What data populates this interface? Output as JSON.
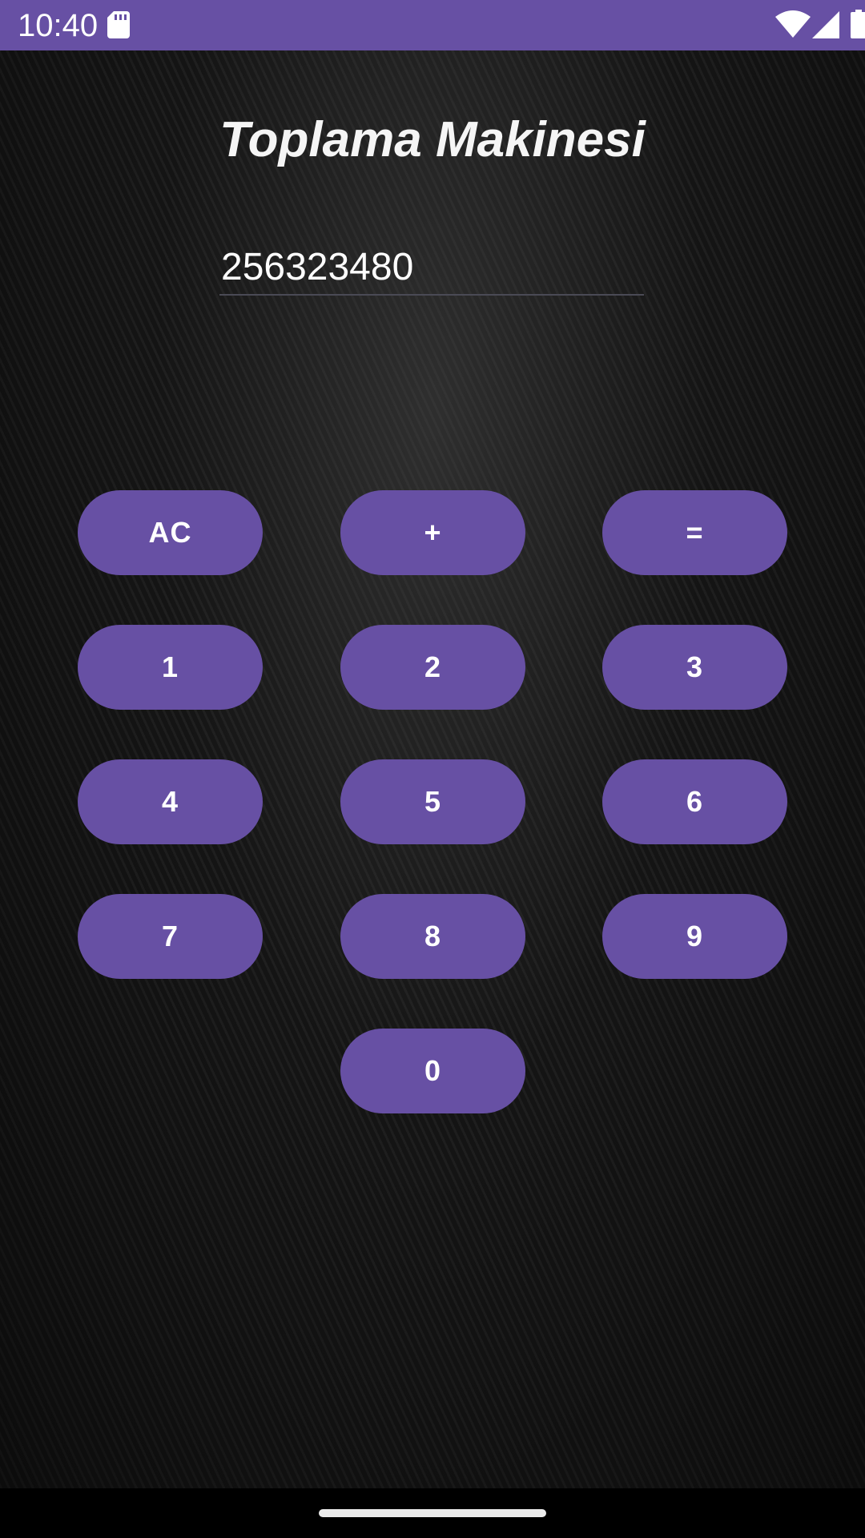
{
  "status_bar": {
    "time": "10:40",
    "background": "#6750a4",
    "icons": [
      "sd-card-icon",
      "wifi-icon",
      "cell-signal-icon",
      "battery-icon"
    ]
  },
  "app": {
    "title": "Toplama Makinesi",
    "display_value": "256323480"
  },
  "keypad": {
    "accent": "#6750a4",
    "row1": [
      "AC",
      "+",
      "="
    ],
    "row2": [
      "1",
      "2",
      "3"
    ],
    "row3": [
      "4",
      "5",
      "6"
    ],
    "row4": [
      "7",
      "8",
      "9"
    ],
    "row5": [
      "0"
    ]
  }
}
